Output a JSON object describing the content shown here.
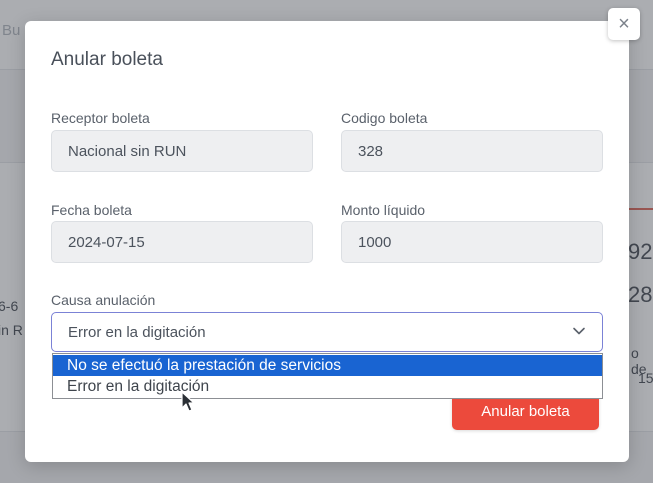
{
  "background": {
    "search_hint": "Bu",
    "left_text_1": "6-6",
    "left_text_2": "in R",
    "right_num_1": "92",
    "right_num_2": "28",
    "right_text_1": "o de",
    "right_text_2": "15"
  },
  "modal": {
    "title": "Anular boleta",
    "close_label": "×",
    "fields": {
      "receptor": {
        "label": "Receptor boleta",
        "value": "Nacional sin RUN"
      },
      "codigo": {
        "label": "Codigo boleta",
        "value": "328"
      },
      "fecha": {
        "label": "Fecha boleta",
        "value": "2024-07-15"
      },
      "monto": {
        "label": "Monto líquido",
        "value": "1000"
      }
    },
    "causa": {
      "label": "Causa anulación",
      "selected": "Error en la digitación",
      "options": [
        "No se efectuó la prestación de servicios",
        "Error en la digitación"
      ],
      "highlighted_option": "No se efectuó la prestación de servicios"
    },
    "submit_label": "Anular boleta"
  },
  "colors": {
    "accent_danger": "#ec4a3c",
    "option_highlight": "#1964d2",
    "focus_border": "#7b82d6"
  },
  "icons": [
    "close-icon",
    "chevron-down-icon",
    "mouse-cursor-icon"
  ]
}
